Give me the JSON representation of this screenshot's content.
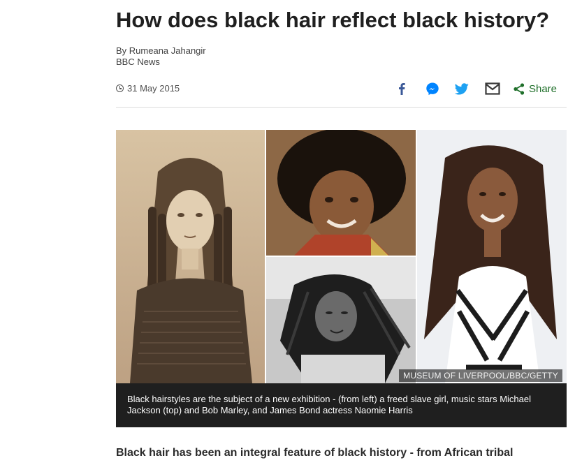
{
  "article": {
    "headline": "How does black hair reflect black history?",
    "author": "By Rumeana Jahangir",
    "outlet": "BBC News",
    "date": "31 May 2015"
  },
  "share": {
    "icons": [
      "facebook-icon",
      "messenger-icon",
      "twitter-icon",
      "email-icon",
      "share-icon"
    ],
    "share_label": "Share"
  },
  "image": {
    "credit": "MUSEUM OF LIVERPOOL/BBC/GETTY",
    "caption": "Black hairstyles are the subject of a new exhibition - (from left) a freed slave girl, music stars Michael Jackson (top) and Bob Marley, and James Bond actress Naomie Harris"
  },
  "body": {
    "lead": "Black hair has been an integral feature of black history - from African tribal"
  },
  "colors": {
    "facebook": "#3b5998",
    "messenger": "#0084ff",
    "twitter": "#1da1f2",
    "share_green": "#1f6f2a"
  }
}
